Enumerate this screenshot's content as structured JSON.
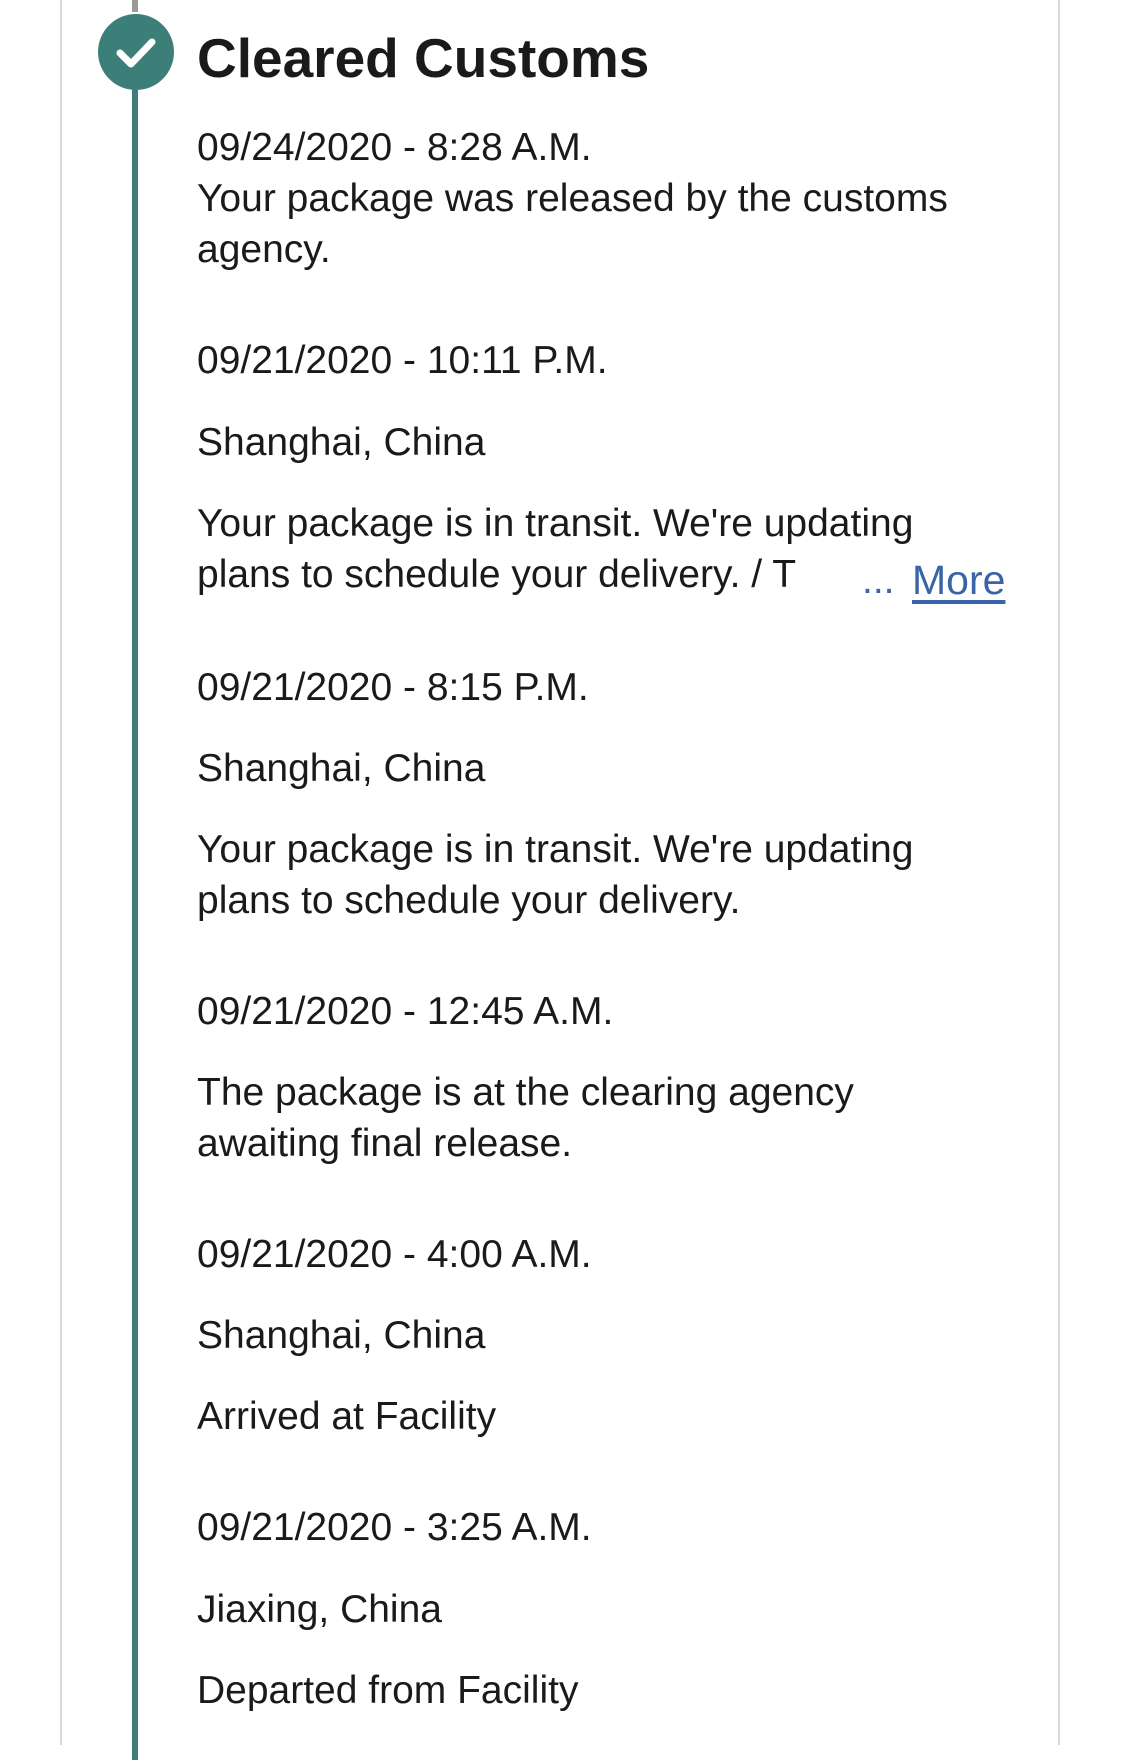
{
  "section": {
    "title": "Cleared Customs",
    "status_icon": "check-icon"
  },
  "events": [
    {
      "datetime": "09/24/2020 - 8:28 A.M.",
      "description_lines": [
        "Your package was released by the customs",
        "agency."
      ]
    },
    {
      "datetime": "09/21/2020 - 10:11 P.M.",
      "location": "Shanghai, China",
      "description_lines": [
        "Your package is in transit. We're updating",
        "plans to schedule your delivery. / T"
      ],
      "ellipsis": "...",
      "more_label": "More"
    },
    {
      "datetime": "09/21/2020 - 8:15 P.M.",
      "location": "Shanghai, China",
      "description_lines": [
        "Your package is in transit. We're updating",
        "plans to schedule your delivery."
      ]
    },
    {
      "datetime": "09/21/2020 - 12:45 A.M.",
      "description_lines": [
        "The package is at the clearing agency",
        "awaiting final release."
      ]
    },
    {
      "datetime": "09/21/2020 - 4:00 A.M.",
      "location": "Shanghai, China",
      "description": "Arrived at Facility"
    },
    {
      "datetime": "09/21/2020 - 3:25 A.M.",
      "location": "Jiaxing, China",
      "description": "Departed from Facility"
    }
  ],
  "colors": {
    "timeline": "#3b7f78",
    "link": "#3a64a8",
    "text": "#1a1a1a",
    "border": "#d9d9d9"
  }
}
